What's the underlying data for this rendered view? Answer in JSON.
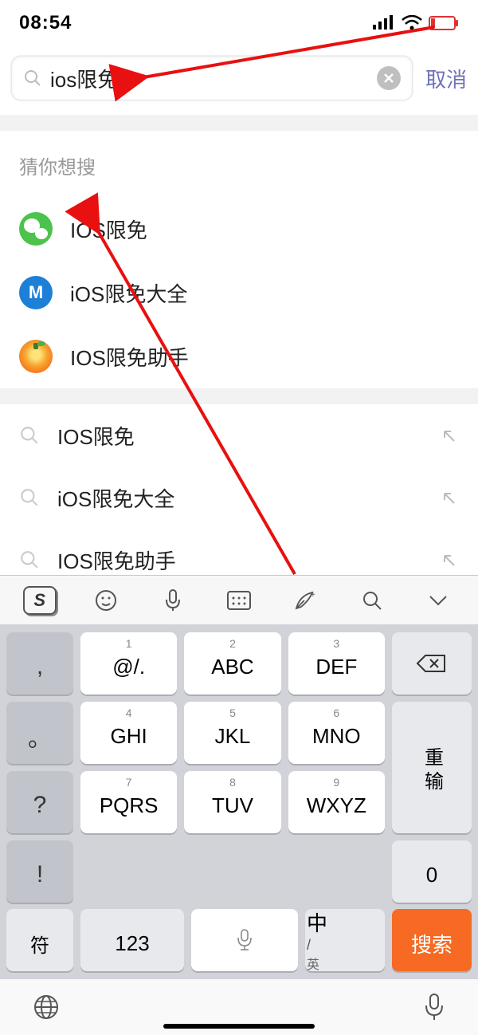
{
  "status": {
    "time": "08:54"
  },
  "search": {
    "value": "ios限免",
    "cancel": "取消"
  },
  "suggest_title": "猜你想搜",
  "suggestions": [
    {
      "label": "IOS限免",
      "icon": "wechat"
    },
    {
      "label": "iOS限免大全",
      "icon": "bluecircle",
      "icon_text": "M"
    },
    {
      "label": "IOS限免助手",
      "icon": "orange"
    }
  ],
  "history": [
    {
      "label": "IOS限免"
    },
    {
      "label": "iOS限免大全"
    },
    {
      "label": "IOS限免助手"
    }
  ],
  "keyboard": {
    "side": [
      ",",
      "。",
      "?",
      "!"
    ],
    "keys": [
      {
        "n": "1",
        "l": "@/."
      },
      {
        "n": "2",
        "l": "ABC"
      },
      {
        "n": "3",
        "l": "DEF"
      },
      {
        "n": "4",
        "l": "GHI"
      },
      {
        "n": "5",
        "l": "JKL"
      },
      {
        "n": "6",
        "l": "MNO"
      },
      {
        "n": "7",
        "l": "PQRS"
      },
      {
        "n": "8",
        "l": "TUV"
      },
      {
        "n": "9",
        "l": "WXYZ"
      }
    ],
    "reinput": "重输",
    "zero": "0",
    "symbol": "符",
    "num": "123",
    "lang_big": "中",
    "lang_small": "英",
    "action": "搜索"
  }
}
